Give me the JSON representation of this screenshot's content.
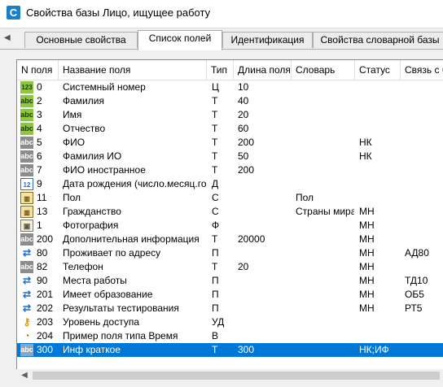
{
  "window": {
    "title": "Свойства базы Лицо, ищущее работу",
    "app_icon": "C"
  },
  "tabs": [
    {
      "label": "Основные свойства",
      "active": false
    },
    {
      "label": "Список полей",
      "active": true
    },
    {
      "label": "Идентификация",
      "active": false
    },
    {
      "label": "Свойства словарной базы",
      "active": false
    }
  ],
  "columns": [
    "N поля",
    "Название поля",
    "Тип",
    "Длина поля",
    "Словарь",
    "Статус",
    "Связь с б"
  ],
  "rows": [
    {
      "icon": "number-icon",
      "glyph": "123",
      "num": "0",
      "name": "Системный номер",
      "type": "Ц",
      "length": "10",
      "dict": "",
      "status": "",
      "link": ""
    },
    {
      "icon": "text-abc-green-icon",
      "glyph": "abc",
      "num": "2",
      "name": "Фамилия",
      "type": "Т",
      "length": "40",
      "dict": "",
      "status": "",
      "link": ""
    },
    {
      "icon": "text-abc-green-icon",
      "glyph": "abc",
      "num": "3",
      "name": "Имя",
      "type": "Т",
      "length": "20",
      "dict": "",
      "status": "",
      "link": ""
    },
    {
      "icon": "text-abc-green-icon",
      "glyph": "abc",
      "num": "4",
      "name": "Отчество",
      "type": "Т",
      "length": "60",
      "dict": "",
      "status": "",
      "link": ""
    },
    {
      "icon": "text-abc-gray-icon",
      "glyph": "abc",
      "num": "5",
      "name": "ФИО",
      "type": "Т",
      "length": "200",
      "dict": "",
      "status": "НК",
      "link": ""
    },
    {
      "icon": "text-abc-gray-icon",
      "glyph": "abc",
      "num": "6",
      "name": "Фамилия ИО",
      "type": "Т",
      "length": "50",
      "dict": "",
      "status": "НК",
      "link": ""
    },
    {
      "icon": "text-abc-gray-icon",
      "glyph": "abc",
      "num": "7",
      "name": "ФИО иностранное",
      "type": "Т",
      "length": "200",
      "dict": "",
      "status": "",
      "link": ""
    },
    {
      "icon": "calendar-icon",
      "glyph": "12",
      "num": "9",
      "name": "Дата рождения (число.месяц.год)",
      "type": "Д",
      "length": "",
      "dict": "",
      "status": "",
      "link": ""
    },
    {
      "icon": "dictionary-book-icon",
      "glyph": "▥",
      "num": "11",
      "name": "Пол",
      "type": "С",
      "length": "",
      "dict": "Пол",
      "status": "",
      "link": ""
    },
    {
      "icon": "dictionary-book-icon",
      "glyph": "▥",
      "num": "13",
      "name": "Гражданство",
      "type": "С",
      "length": "",
      "dict": "Страны мира",
      "status": "МН",
      "link": ""
    },
    {
      "icon": "photo-icon",
      "glyph": "▣",
      "num": "1",
      "name": "Фотография",
      "type": "Ф",
      "length": "",
      "dict": "",
      "status": "МН",
      "link": ""
    },
    {
      "icon": "text-abc-gray-icon",
      "glyph": "abc",
      "num": "200",
      "name": "Дополнительная информация",
      "type": "Т",
      "length": "20000",
      "dict": "",
      "status": "МН",
      "link": ""
    },
    {
      "icon": "link-arrows-icon",
      "glyph": "⇄",
      "num": "80",
      "name": "Проживает по адресу",
      "type": "П",
      "length": "",
      "dict": "",
      "status": "МН",
      "link": "АД80"
    },
    {
      "icon": "text-abc-gray-icon",
      "glyph": "abc",
      "num": "82",
      "name": "Телефон",
      "type": "Т",
      "length": "20",
      "dict": "",
      "status": "МН",
      "link": ""
    },
    {
      "icon": "link-arrows-icon",
      "glyph": "⇄",
      "num": "90",
      "name": "Места работы",
      "type": "П",
      "length": "",
      "dict": "",
      "status": "МН",
      "link": "ТД10"
    },
    {
      "icon": "link-arrows-icon",
      "glyph": "⇄",
      "num": "201",
      "name": "Имеет образование",
      "type": "П",
      "length": "",
      "dict": "",
      "status": "МН",
      "link": "ОБ5"
    },
    {
      "icon": "link-arrows-icon",
      "glyph": "⇄",
      "num": "202",
      "name": "Результаты тестирования",
      "type": "П",
      "length": "",
      "dict": "",
      "status": "МН",
      "link": "РТ5"
    },
    {
      "icon": "key-icon",
      "glyph": "⚷",
      "num": "203",
      "name": "Уровень доступа",
      "type": "УД",
      "length": "",
      "dict": "",
      "status": "",
      "link": ""
    },
    {
      "icon": "clock-icon",
      "glyph": "◔",
      "num": "204",
      "name": "Пример поля типа Время",
      "type": "В",
      "length": "",
      "dict": "",
      "status": "",
      "link": ""
    },
    {
      "icon": "text-abc-gray-icon",
      "glyph": "abc",
      "num": "300",
      "name": "Инф краткое",
      "type": "Т",
      "length": "300",
      "dict": "",
      "status": "НК;ИФ",
      "link": "",
      "selected": true
    }
  ],
  "colors": {
    "selection": "#0078d7",
    "grid_border": "#8a8a8a",
    "tab_bg": "#f0f0f0"
  }
}
